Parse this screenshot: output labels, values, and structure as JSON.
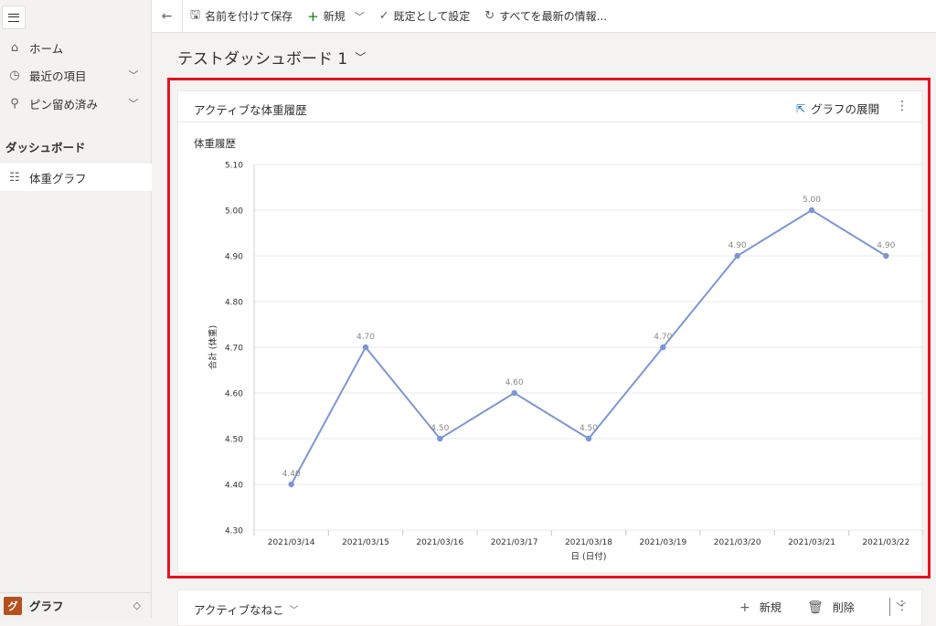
{
  "toolbar": {
    "save_as": "名前を付けて保存",
    "new": "新規",
    "set_default": "既定として設定",
    "refresh_all": "すべてを最新の情報..."
  },
  "sidebar": {
    "items": [
      {
        "label": "ホーム",
        "icon": "home-icon"
      },
      {
        "label": "最近の項目",
        "icon": "clock-icon"
      },
      {
        "label": "ピン留め済み",
        "icon": "pin-icon"
      }
    ],
    "section_title": "ダッシュボード",
    "selected_item": "体重グラフ",
    "app_badge": "グ",
    "app_name": "グラフ"
  },
  "dashboard": {
    "title": "テストダッシュボード 1"
  },
  "card": {
    "title": "アクティブな体重履歴",
    "expand_label": "グラフの展開"
  },
  "chart_data": {
    "type": "line",
    "title": "体重履歴",
    "xlabel": "日 (日付)",
    "ylabel": "合計 (体重)",
    "categories": [
      "2021/03/14",
      "2021/03/15",
      "2021/03/16",
      "2021/03/17",
      "2021/03/18",
      "2021/03/19",
      "2021/03/20",
      "2021/03/21",
      "2021/03/22"
    ],
    "values": [
      4.4,
      4.7,
      4.5,
      4.6,
      4.5,
      4.7,
      4.9,
      5.0,
      4.9
    ],
    "data_labels": [
      "4.40",
      "4.70",
      "4.50",
      "4.60",
      "4.50",
      "4.70",
      "4.90",
      "5.00",
      "4.90"
    ],
    "ylim": [
      4.3,
      5.1
    ],
    "yticks": [
      "4.30",
      "4.40",
      "4.50",
      "4.60",
      "4.70",
      "4.80",
      "4.90",
      "5.00",
      "5.10"
    ],
    "grid": true,
    "color": "#7b96d4"
  },
  "card2": {
    "title": "アクティブなねこ",
    "new": "新規",
    "delete": "削除"
  }
}
